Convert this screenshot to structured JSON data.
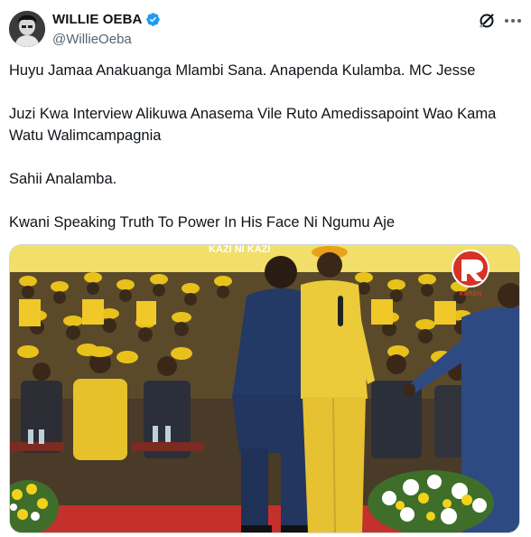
{
  "author": {
    "display_name": "WILLIE OEBA",
    "handle": "@WillieOeba",
    "verified": true,
    "verified_color": "#1d9bf0"
  },
  "actions": {
    "grok_icon": "grok-icon",
    "more_icon": "more-options-icon"
  },
  "tweet": {
    "paragraphs": [
      "Huyu Jamaa Anakuanga Mlambi Sana. Anapenda Kulamba. MC Jesse",
      "Juzi Kwa Interview Alikuwa Anasema Vile Ruto Amedissapoint Wao Kama Watu Walimcampagnia",
      "Sahii Analamba.",
      "Kwani Speaking Truth To Power In His Face Ni Ngumu Aje"
    ]
  },
  "media": {
    "banner_text": "KAZI NI KAZI",
    "watermark": "KAREN",
    "colors": {
      "crowd_yellow": "#e8c21a",
      "stage_red": "#c4302b",
      "suit_navy": "#243a66"
    }
  }
}
